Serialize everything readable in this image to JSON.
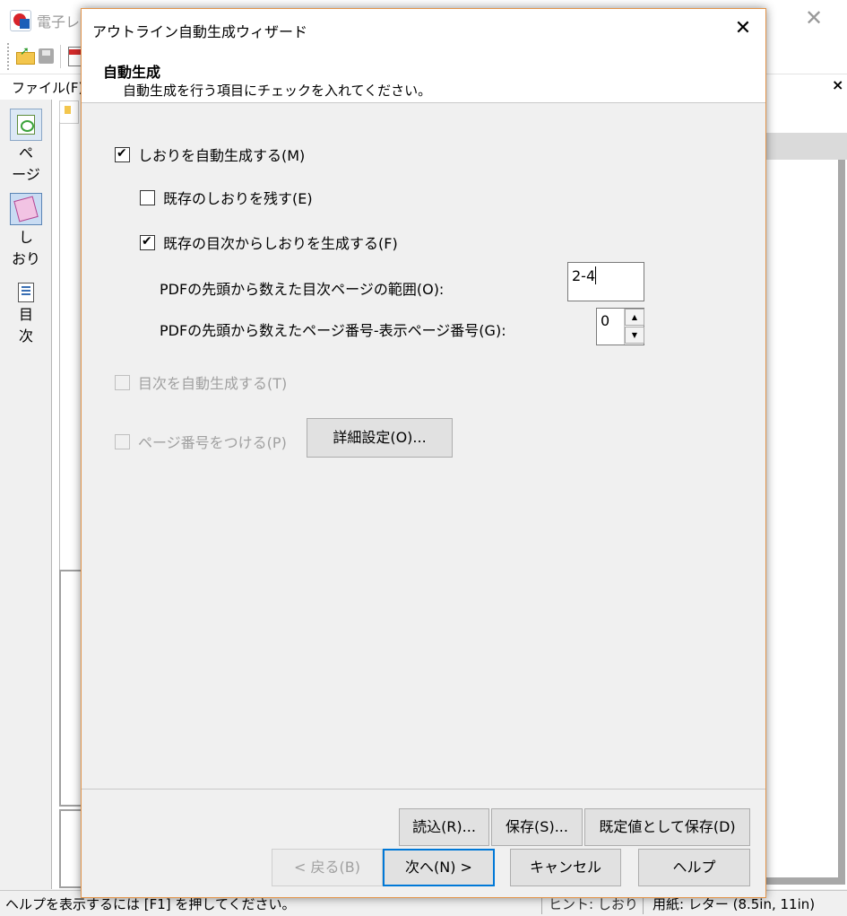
{
  "app": {
    "title": "電子レ",
    "close_glyph": "✕",
    "menu": {
      "file_label": "ファイル(F)",
      "close_glyph": "×"
    },
    "left_panel": [
      {
        "label": "ペ\nージ",
        "icon": "page-icon"
      },
      {
        "label": "し\nおり",
        "icon": "bookmark-icon"
      },
      {
        "label": "目\n次",
        "icon": "toc-icon"
      }
    ],
    "statusbar": {
      "help": "ヘルプを表示するには [F1] を押してください。",
      "mode": "ヒント: しおり",
      "paper": "用紙: レター (8.5in, 11in)"
    }
  },
  "dialog": {
    "title": "アウトライン自動生成ウィザード",
    "close_glyph": "✕",
    "header": {
      "title": "自動生成",
      "subtitle": "自動生成を行う項目にチェックを入れてください。"
    },
    "options": {
      "auto_bookmark": {
        "label": "しおりを自動生成する(M)",
        "checked": true,
        "enabled": true
      },
      "keep_existing": {
        "label": "既存のしおりを残す(E)",
        "checked": false,
        "enabled": true
      },
      "from_toc": {
        "label": "既存の目次からしおりを生成する(F)",
        "checked": true,
        "enabled": true
      },
      "toc_range": {
        "label": "PDFの先頭から数えた目次ページの範囲(O):",
        "value": "2-4"
      },
      "page_offset": {
        "label": "PDFの先頭から数えたページ番号-表示ページ番号(G):",
        "value": "0",
        "up": "▲",
        "down": "▼"
      },
      "auto_toc": {
        "label": "目次を自動生成する(T)",
        "checked": false,
        "enabled": false
      },
      "page_numbers": {
        "label": "ページ番号をつける(P)",
        "checked": false,
        "enabled": false
      }
    },
    "buttons": {
      "detail_settings": "詳細設定(O)...",
      "load": "読込(R)...",
      "save": "保存(S)...",
      "save_default": "既定値として保存(D)",
      "back": "< 戻る(B)",
      "next": "次へ(N) >",
      "cancel": "キャンセル",
      "help": "ヘルプ"
    }
  }
}
